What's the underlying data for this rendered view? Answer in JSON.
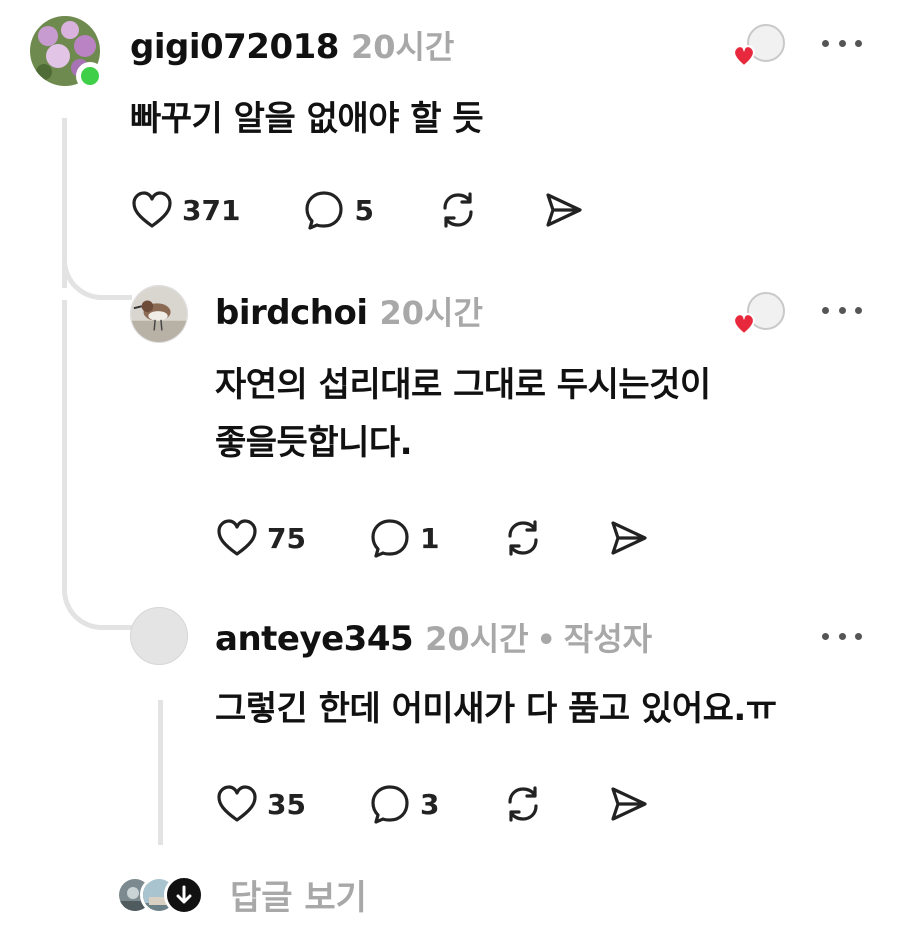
{
  "comments": [
    {
      "username": "gigi072018",
      "time": "20시간",
      "text": [
        "빠꾸기 알을 없애야 할 듯"
      ],
      "likes": "371",
      "replies": "5"
    },
    {
      "username": "birdchoi",
      "time": "20시간",
      "text": [
        "자연의 섭리대로 그대로 두시는것이",
        "좋을듯합니다."
      ],
      "likes": "75",
      "replies": "1"
    },
    {
      "username": "anteye345",
      "time": "20시간",
      "separator": "•",
      "author_badge": "작성자",
      "text": [
        "그렇긴 한데 어미새가 다 품고 있어요.ㅠ"
      ],
      "likes": "35",
      "replies": "3"
    }
  ],
  "view_replies": {
    "label": "답글 보기"
  },
  "icons": {
    "like": "heart-outline-icon",
    "comment": "comment-bubble-icon",
    "repost": "repost-icon",
    "share": "send-icon",
    "more": "more-dots-icon",
    "liked_by_author": "author-liked-heart-icon",
    "expand": "arrow-down-icon"
  },
  "colors": {
    "online": "#3fcf49",
    "heart": "#e8283c",
    "muted": "#a8a8a8",
    "thread": "#e3e3e3"
  }
}
